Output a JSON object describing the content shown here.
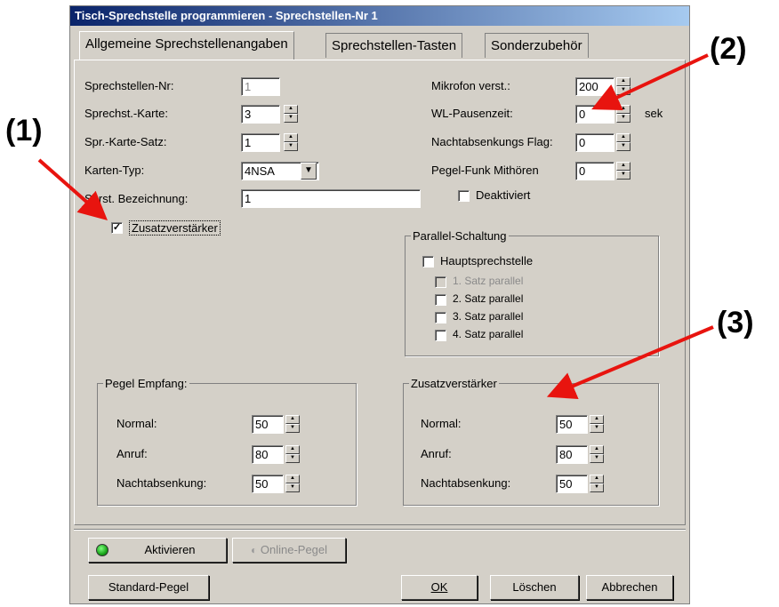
{
  "window": {
    "title": "Tisch-Sprechstelle programmieren - Sprechstellen-Nr 1"
  },
  "tabs": [
    {
      "label": "Allgemeine Sprechstellenangaben",
      "active": true
    },
    {
      "label": "Sprechstellen-Tasten",
      "active": false
    },
    {
      "label": "Sonderzubehör",
      "active": false
    }
  ],
  "left_fields": {
    "sprechstellen_nr": {
      "label": "Sprechstellen-Nr:",
      "value": "1"
    },
    "sprechst_karte": {
      "label": "Sprechst.-Karte:",
      "value": "3"
    },
    "spr_karte_satz": {
      "label": "Spr.-Karte-Satz:",
      "value": "1"
    },
    "karten_typ": {
      "label": "Karten-Typ:",
      "value": "4NSA"
    },
    "sprst_bezeichnung": {
      "label": "Sprst. Bezeichnung:",
      "value": "1"
    },
    "zusatzverstaerker": {
      "label": "Zusatzverstärker",
      "checked": true
    }
  },
  "right_fields": {
    "mikrofon": {
      "label": "Mikrofon verst.:",
      "value": "200"
    },
    "wl_pausenzeit": {
      "label": "WL-Pausenzeit:",
      "value": "0",
      "unit": "sek"
    },
    "nachtabsenkungs_flag": {
      "label": "Nachtabsenkungs Flag:",
      "value": "0"
    },
    "pegel_funk": {
      "label": "Pegel-Funk Mithören",
      "value": "0"
    },
    "deaktiviert": {
      "label": "Deaktiviert",
      "checked": false
    }
  },
  "parallel": {
    "title": "Parallel-Schaltung",
    "haupt": {
      "label": "Hauptsprechstelle",
      "checked": false
    },
    "items": [
      {
        "label": "1. Satz parallel",
        "disabled": true
      },
      {
        "label": "2. Satz parallel",
        "disabled": false
      },
      {
        "label": "3. Satz parallel",
        "disabled": false
      },
      {
        "label": "4. Satz parallel",
        "disabled": false
      }
    ]
  },
  "pegel_empfang": {
    "title": "Pegel Empfang:",
    "rows": [
      {
        "label": "Normal:",
        "value": "50"
      },
      {
        "label": "Anruf:",
        "value": "80"
      },
      {
        "label": "Nachtabsenkung:",
        "value": "50"
      }
    ]
  },
  "zusatz_group": {
    "title": "Zusatzverstärker",
    "rows": [
      {
        "label": "Normal:",
        "value": "50"
      },
      {
        "label": "Anruf:",
        "value": "80"
      },
      {
        "label": "Nachtabsenkung:",
        "value": "50"
      }
    ]
  },
  "buttons": {
    "aktivieren": "Aktivieren",
    "online_pegel": "Online-Pegel",
    "standard_pegel": "Standard-Pegel",
    "ok": "OK",
    "loeschen": "Löschen",
    "abbrechen": "Abbrechen"
  },
  "annotations": {
    "a1": "(1)",
    "a2": "(2)",
    "a3": "(3)"
  },
  "colors": {
    "title_bar": "#0a246a",
    "arrow": "#e8140f",
    "led": "#1aa51a"
  }
}
